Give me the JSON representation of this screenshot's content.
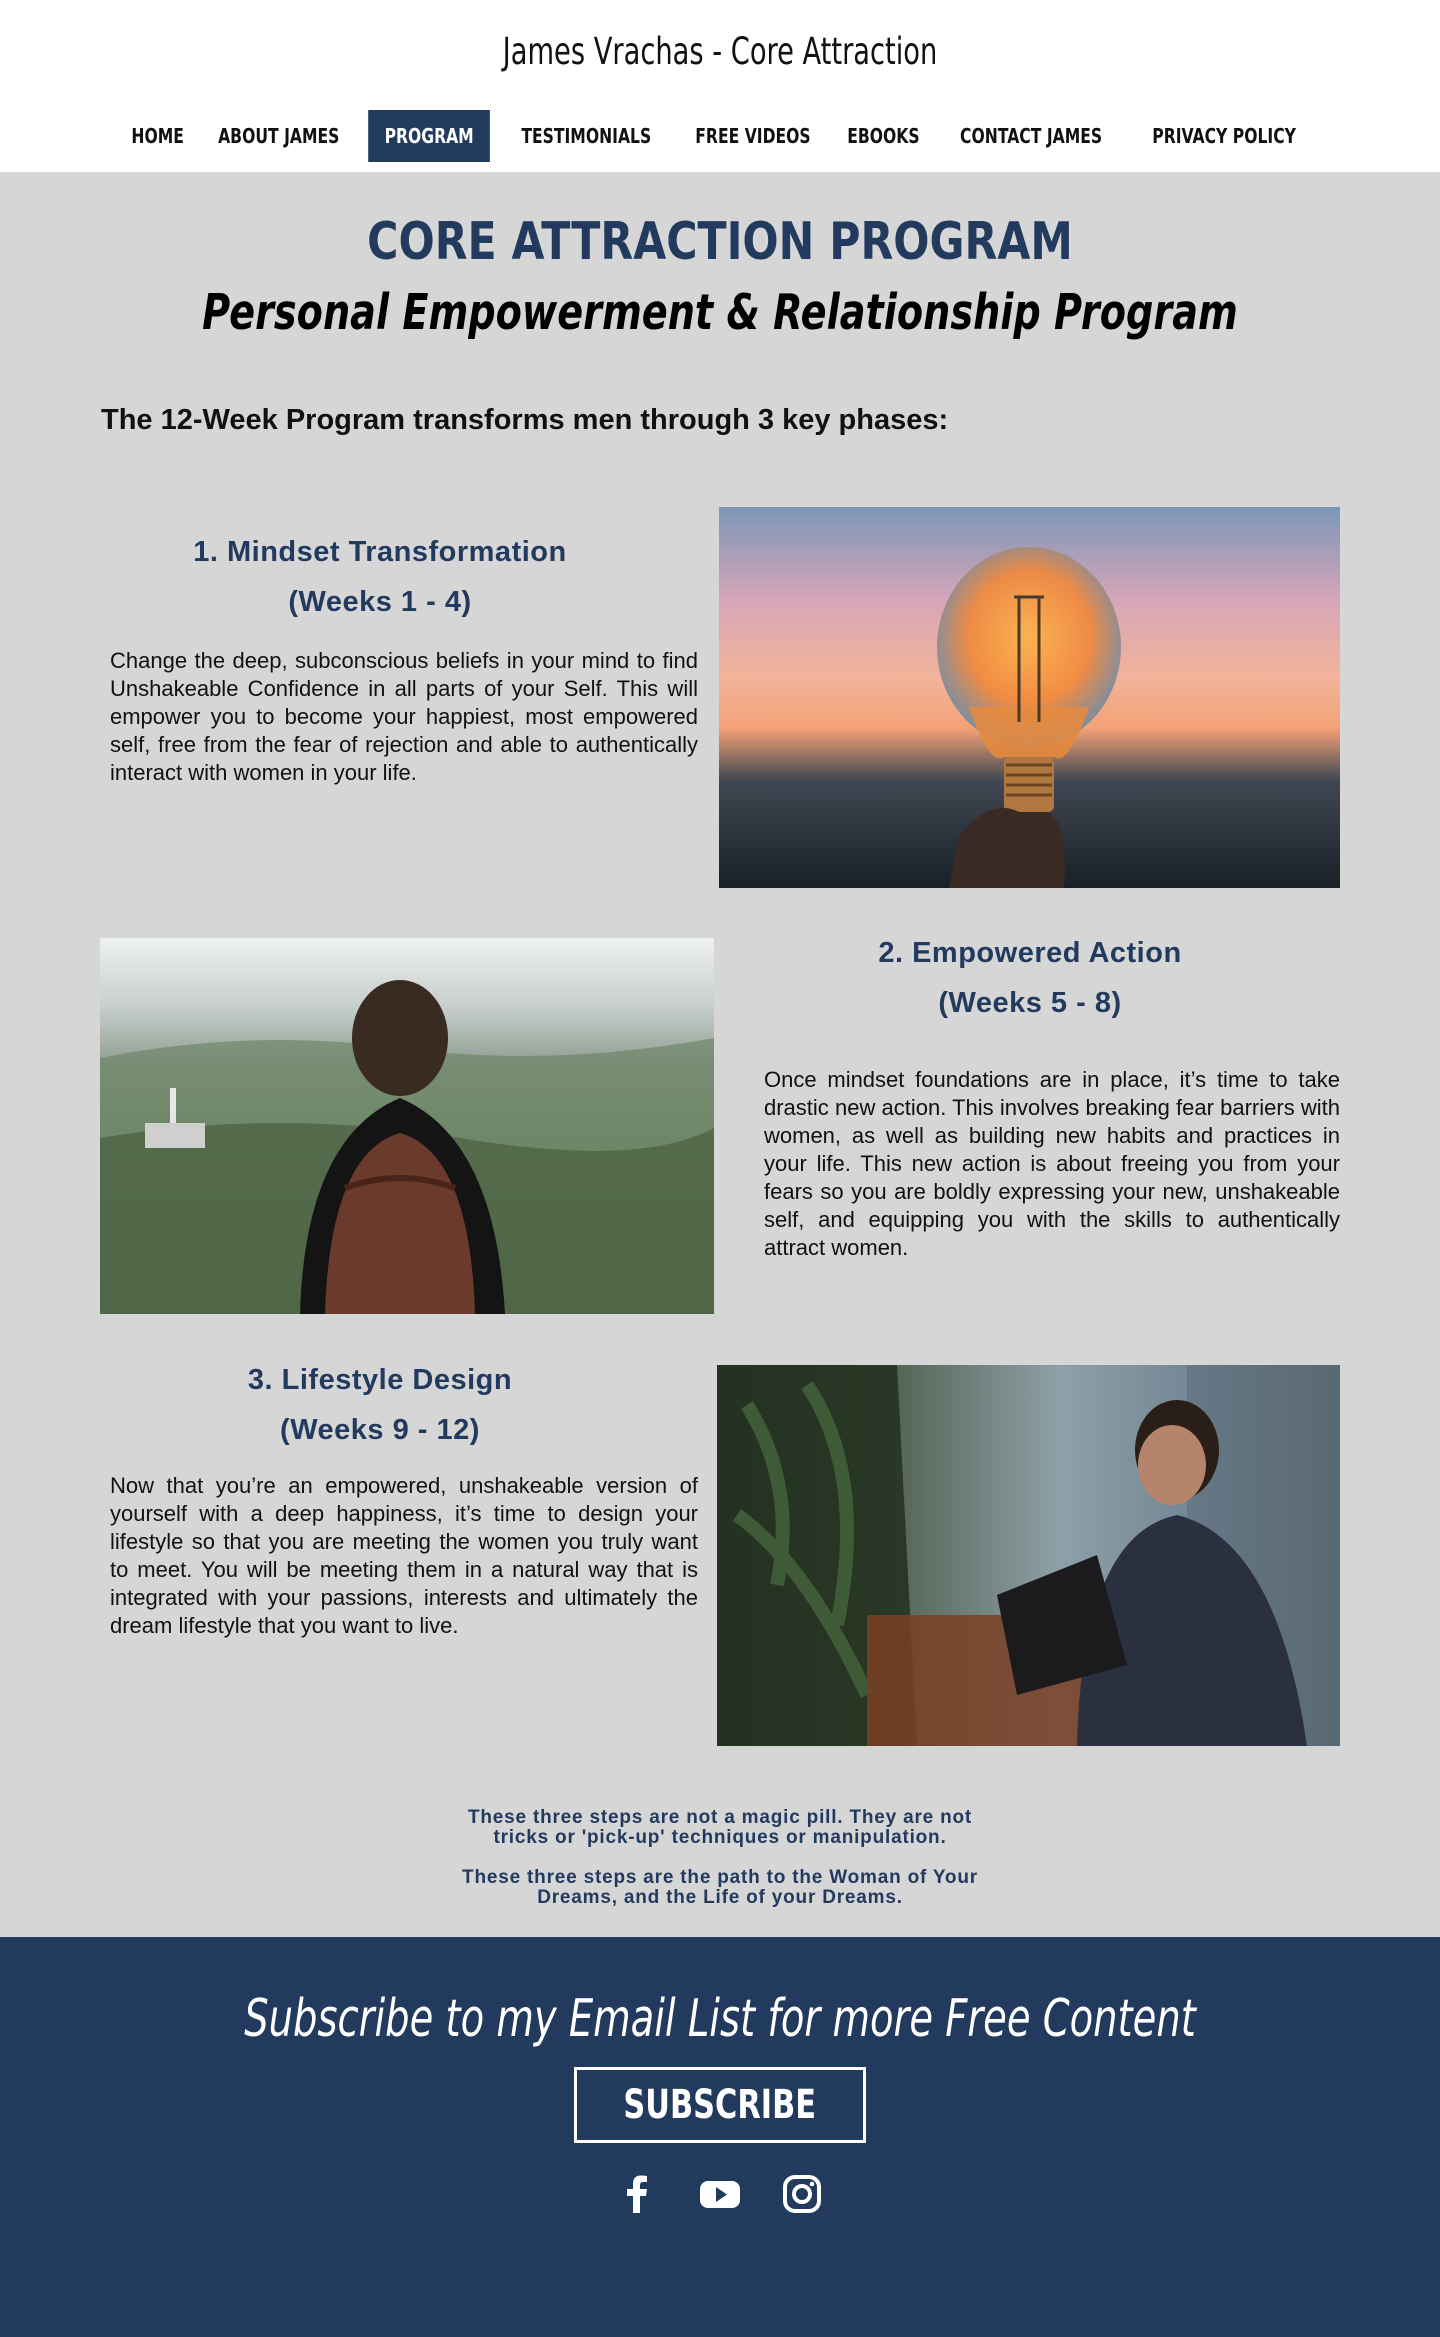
{
  "header": {
    "site_title": "James Vrachas - Core Attraction",
    "nav": [
      {
        "label": "HOME"
      },
      {
        "label": "ABOUT JAMES"
      },
      {
        "label": "PROGRAM",
        "active": true
      },
      {
        "label": "TESTIMONIALS"
      },
      {
        "label": "FREE VIDEOS"
      },
      {
        "label": "EBOOKS"
      },
      {
        "label": "CONTACT JAMES"
      },
      {
        "label": "PRIVACY POLICY"
      }
    ]
  },
  "main": {
    "title": "CORE ATTRACTION PROGRAM",
    "subtitle": "Personal Empowerment & Relationship Program",
    "intro": "The 12-Week Program transforms men through 3 key phases:",
    "phases": [
      {
        "title": "1. Mindset Transformation",
        "weeks": "(Weeks 1 - 4)",
        "text": "Change the deep, subconscious beliefs in your mind to find Unshakeable Confidence in all parts of your Self. This will empower you to become your happiest, most empowered self, free from the fear of rejection and able to authentically interact with women in your life."
      },
      {
        "title": "2. Empowered Action",
        "weeks": "(Weeks 5 - 8)",
        "text": "Once mindset foundations are in place, it’s time to take drastic new action. This involves breaking fear barriers with women, as well as building new habits and practices in your life. This new action is about freeing you from your fears so you are boldly expressing your new, unshakeable self, and equipping you with the skills to authentically attract women."
      },
      {
        "title": "3. Lifestyle Design",
        "weeks": "(Weeks 9 - 12)",
        "text": "Now that you’re an empowered, unshakeable version of yourself with a deep happiness, it’s time to design your lifestyle so that you are meeting the women you truly want to meet. You will be meeting them in a natural way that is integrated with your passions, interests and ultimately the dream lifestyle that you want to live."
      }
    ],
    "closing_1_line1": "These three steps are not a magic pill. They are not",
    "closing_1_line2": "tricks or 'pick-up' techniques or manipulation.",
    "closing_2_line1": "These three steps are the path to the Woman of Your",
    "closing_2_line2": "Dreams, and the Life of your Dreams."
  },
  "footer": {
    "heading": "Subscribe to my Email List for more Free Content",
    "button": "SUBSCRIBE",
    "social_icons": [
      "facebook-icon",
      "youtube-icon",
      "instagram-icon"
    ]
  },
  "colors": {
    "brand_navy": "#223a5e",
    "page_bg": "#d6d6d6"
  }
}
